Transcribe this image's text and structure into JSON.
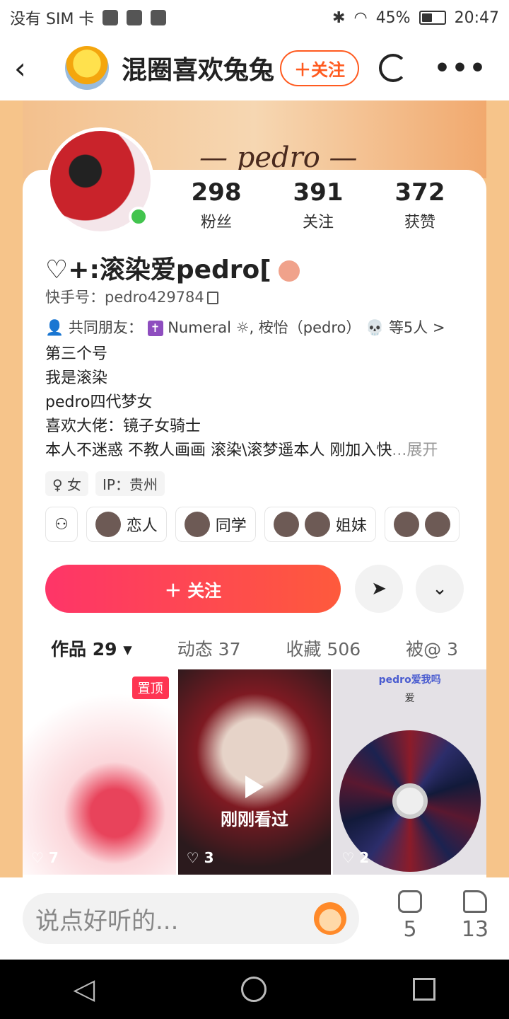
{
  "status_bar": {
    "carrier": "没有 SIM 卡",
    "battery": "45%",
    "time": "20:47",
    "battery_level": 0.45
  },
  "header": {
    "title": "混圈喜欢兔兔",
    "follow_label": "＋关注"
  },
  "banner": {
    "signature": "— pedro —"
  },
  "stats": [
    {
      "value": "298",
      "label": "粉丝"
    },
    {
      "value": "391",
      "label": "关注"
    },
    {
      "value": "372",
      "label": "获赞"
    }
  ],
  "profile": {
    "name": "♡+:滚染爱pedro[",
    "kuaishou_id": "快手号：pedro429784",
    "mutual_friends": "共同朋友：",
    "mutual_names": "Numeral ☼, 桉怡（pedro）",
    "mutual_more": "等5人 >",
    "bio_lines": [
      "第三个号",
      "我是滚染",
      "pedro四代梦女",
      "喜欢大佬：镜子女骑士",
      "本人不迷惑 不教人画画 滚染\\滚梦遥本人 刚加入快"
    ],
    "bio_more": "...展开",
    "tags": [
      "♀ 女",
      "IP：贵州"
    ]
  },
  "relations": [
    {
      "label": "恋人"
    },
    {
      "label": "同学"
    },
    {
      "label": "姐妹"
    }
  ],
  "actions": {
    "follow_main": "＋ 关注"
  },
  "tabs": [
    {
      "label": "作品 29 ▾"
    },
    {
      "label": "动态 37"
    },
    {
      "label": "收藏 506"
    },
    {
      "label": "被@ 3"
    }
  ],
  "grid": [
    {
      "likes": "♡ 7",
      "pin": "置顶"
    },
    {
      "likes": "♡ 3",
      "overlay": "刚刚看过"
    },
    {
      "likes": "♡ 2",
      "title": "pedro爱我吗",
      "subtitle": "爱"
    }
  ],
  "comment_bar": {
    "placeholder": "说点好听的...",
    "comments": "5",
    "likes": "13"
  },
  "colors": {
    "accent": "#fe3568",
    "follow_outline": "#ff5a1f",
    "online": "#42c44e"
  }
}
